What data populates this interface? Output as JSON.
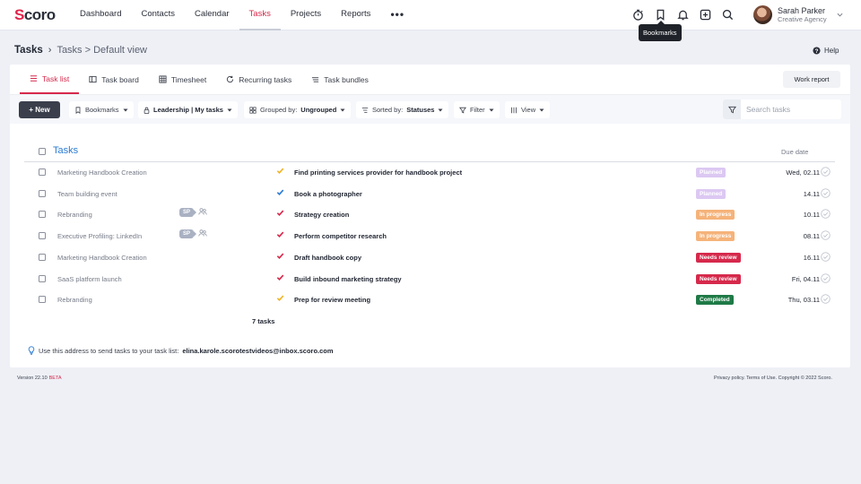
{
  "header": {
    "logo": "Scoro",
    "nav": [
      "Dashboard",
      "Contacts",
      "Calendar",
      "Tasks",
      "Projects",
      "Reports"
    ],
    "active_nav": "Tasks",
    "more": "•••",
    "icons": [
      "stopwatch-icon",
      "bookmark-icon",
      "bell-icon",
      "plus-square-icon",
      "search-icon"
    ],
    "user": {
      "name": "Sarah Parker",
      "company": "Creative Agency"
    },
    "tooltip": "Bookmarks"
  },
  "breadcrumb": {
    "title": "Tasks",
    "path": "Tasks > Default view"
  },
  "help": "Help",
  "tabs": [
    "Task list",
    "Task board",
    "Timesheet",
    "Recurring tasks",
    "Task bundles"
  ],
  "active_tab": "Task list",
  "work_report": "Work report",
  "toolbar": {
    "new": "+ New",
    "bookmarks": "Bookmarks",
    "view_filter": "Leadership | My tasks",
    "grouped_label": "Grouped by:",
    "grouped_value": "Ungrouped",
    "sorted_label": "Sorted by:",
    "sorted_value": "Statuses",
    "filter": "Filter",
    "view": "View",
    "search_placeholder": "Search tasks"
  },
  "table": {
    "title": "Tasks",
    "due_header": "Due date",
    "rows": [
      {
        "project": "Marketing Handbook Creation",
        "task": "Find printing services provider for handbook project",
        "status": "Planned",
        "due": "Wed, 02.11",
        "tick": "#f0b429",
        "color": "#dcc8f2",
        "sp": false
      },
      {
        "project": "Team building event",
        "task": "Book a photographer",
        "status": "Planned",
        "due": "14.11",
        "tick": "#2b7bd3",
        "color": "#dcc8f2",
        "sp": false
      },
      {
        "project": "Rebranding",
        "task": "Strategy creation",
        "status": "In progress",
        "due": "10.11",
        "tick": "#d6294b",
        "color": "#f5b37a",
        "sp": true
      },
      {
        "project": "Executive Profiling: LinkedIn",
        "task": "Perform competitor research",
        "status": "In progress",
        "due": "08.11",
        "tick": "#d6294b",
        "color": "#f5b37a",
        "sp": true
      },
      {
        "project": "Marketing Handbook Creation",
        "task": "Draft handbook copy",
        "status": "Needs review",
        "due": "16.11",
        "tick": "#d6294b",
        "color": "#d6294b",
        "sp": false
      },
      {
        "project": "SaaS platform launch",
        "task": "Build inbound marketing strategy",
        "status": "Needs review",
        "due": "Fri, 04.11",
        "tick": "#d6294b",
        "color": "#d6294b",
        "sp": false
      },
      {
        "project": "Rebranding",
        "task": "Prep for review meeting",
        "status": "Completed",
        "due": "Thu, 03.11",
        "tick": "#f0b429",
        "color": "#1f7a46",
        "sp": false
      }
    ],
    "sp_label": "SP",
    "count": "7 tasks"
  },
  "email_hint": {
    "text": "Use this address to send tasks to your task list:",
    "address": "elina.karole.scorotestvideos@inbox.scoro.com"
  },
  "footer": {
    "version": "Version 22.10",
    "beta": "BETA",
    "legal": "Privacy policy. Terms of Use. Copyright © 2022 Scoro."
  }
}
